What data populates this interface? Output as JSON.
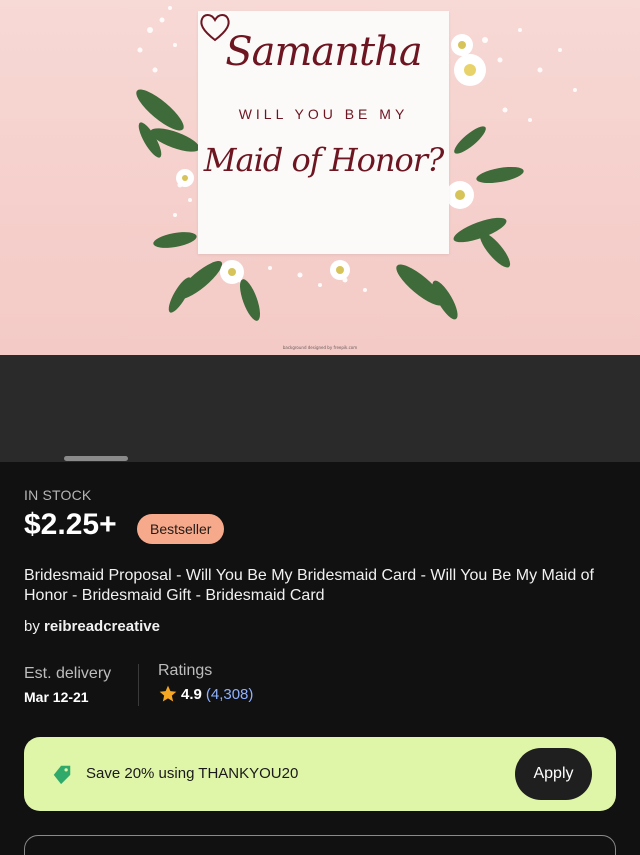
{
  "product_image": {
    "card_name": "Samantha",
    "card_line": "WILL YOU BE MY",
    "card_role": "Maid of Honor?",
    "credit": "background designed by freepik.com"
  },
  "listing": {
    "stock_status": "IN STOCK",
    "price": "$2.25+",
    "badge": "Bestseller",
    "title": "Bridesmaid Proposal - Will You Be My Bridesmaid Card - Will You Be My Maid of Honor  - Bridesmaid Gift - Bridesmaid Card",
    "seller_prefix": "by",
    "seller_name": "reibreadcreative"
  },
  "delivery": {
    "label": "Est. delivery",
    "value": "Mar 12-21"
  },
  "ratings": {
    "label": "Ratings",
    "value": "4.9",
    "count": "(4,308)"
  },
  "promo": {
    "text": "Save 20% using THANKYOU20",
    "apply_label": "Apply"
  },
  "colors": {
    "background": "#111111",
    "badge": "#f6a98b",
    "promo_bg": "#dff5a8",
    "link": "#8fb1ff",
    "star": "#f5a623",
    "card_ink": "#6d1622"
  },
  "icons": [
    "tag-icon",
    "star-icon",
    "heart-icon"
  ]
}
